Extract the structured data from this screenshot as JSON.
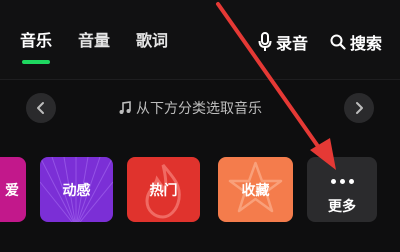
{
  "tabs": [
    {
      "label": "音乐",
      "active": true
    },
    {
      "label": "音量",
      "active": false
    },
    {
      "label": "歌词",
      "active": false
    }
  ],
  "actions": {
    "record": "录音",
    "search": "搜索"
  },
  "hint": {
    "text": "从下方分类选取音乐"
  },
  "categories": [
    {
      "label": "爱",
      "color": "#c2188b"
    },
    {
      "label": "动感",
      "color": "#8a2be2"
    },
    {
      "label": "热门",
      "color": "#e53935"
    },
    {
      "label": "收藏",
      "color": "#ff8a50"
    }
  ],
  "more": {
    "label": "更多"
  },
  "colors": {
    "accent": "#1ed760",
    "annotation_arrow": "#e53935"
  }
}
